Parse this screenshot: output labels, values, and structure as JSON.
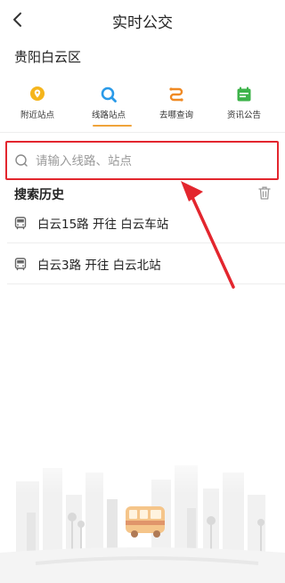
{
  "header": {
    "title": "实时公交"
  },
  "city": "贵阳白云区",
  "tabs": [
    {
      "label": "附近站点",
      "icon": "location-pin-icon",
      "color": "#f5b51c"
    },
    {
      "label": "线路站点",
      "icon": "search-icon",
      "color": "#2a9ae8",
      "active": true
    },
    {
      "label": "去哪查询",
      "icon": "route-icon",
      "color": "#f08a24"
    },
    {
      "label": "资讯公告",
      "icon": "calendar-icon",
      "color": "#3db34a"
    }
  ],
  "search": {
    "placeholder": "请输入线路、站点",
    "value": ""
  },
  "history": {
    "title": "搜索历史",
    "items": [
      {
        "text": "白云15路 开往 白云车站"
      },
      {
        "text": "白云3路 开往 白云北站"
      }
    ]
  },
  "colors": {
    "accent": "#f0a33a",
    "highlight": "#e3262e"
  }
}
